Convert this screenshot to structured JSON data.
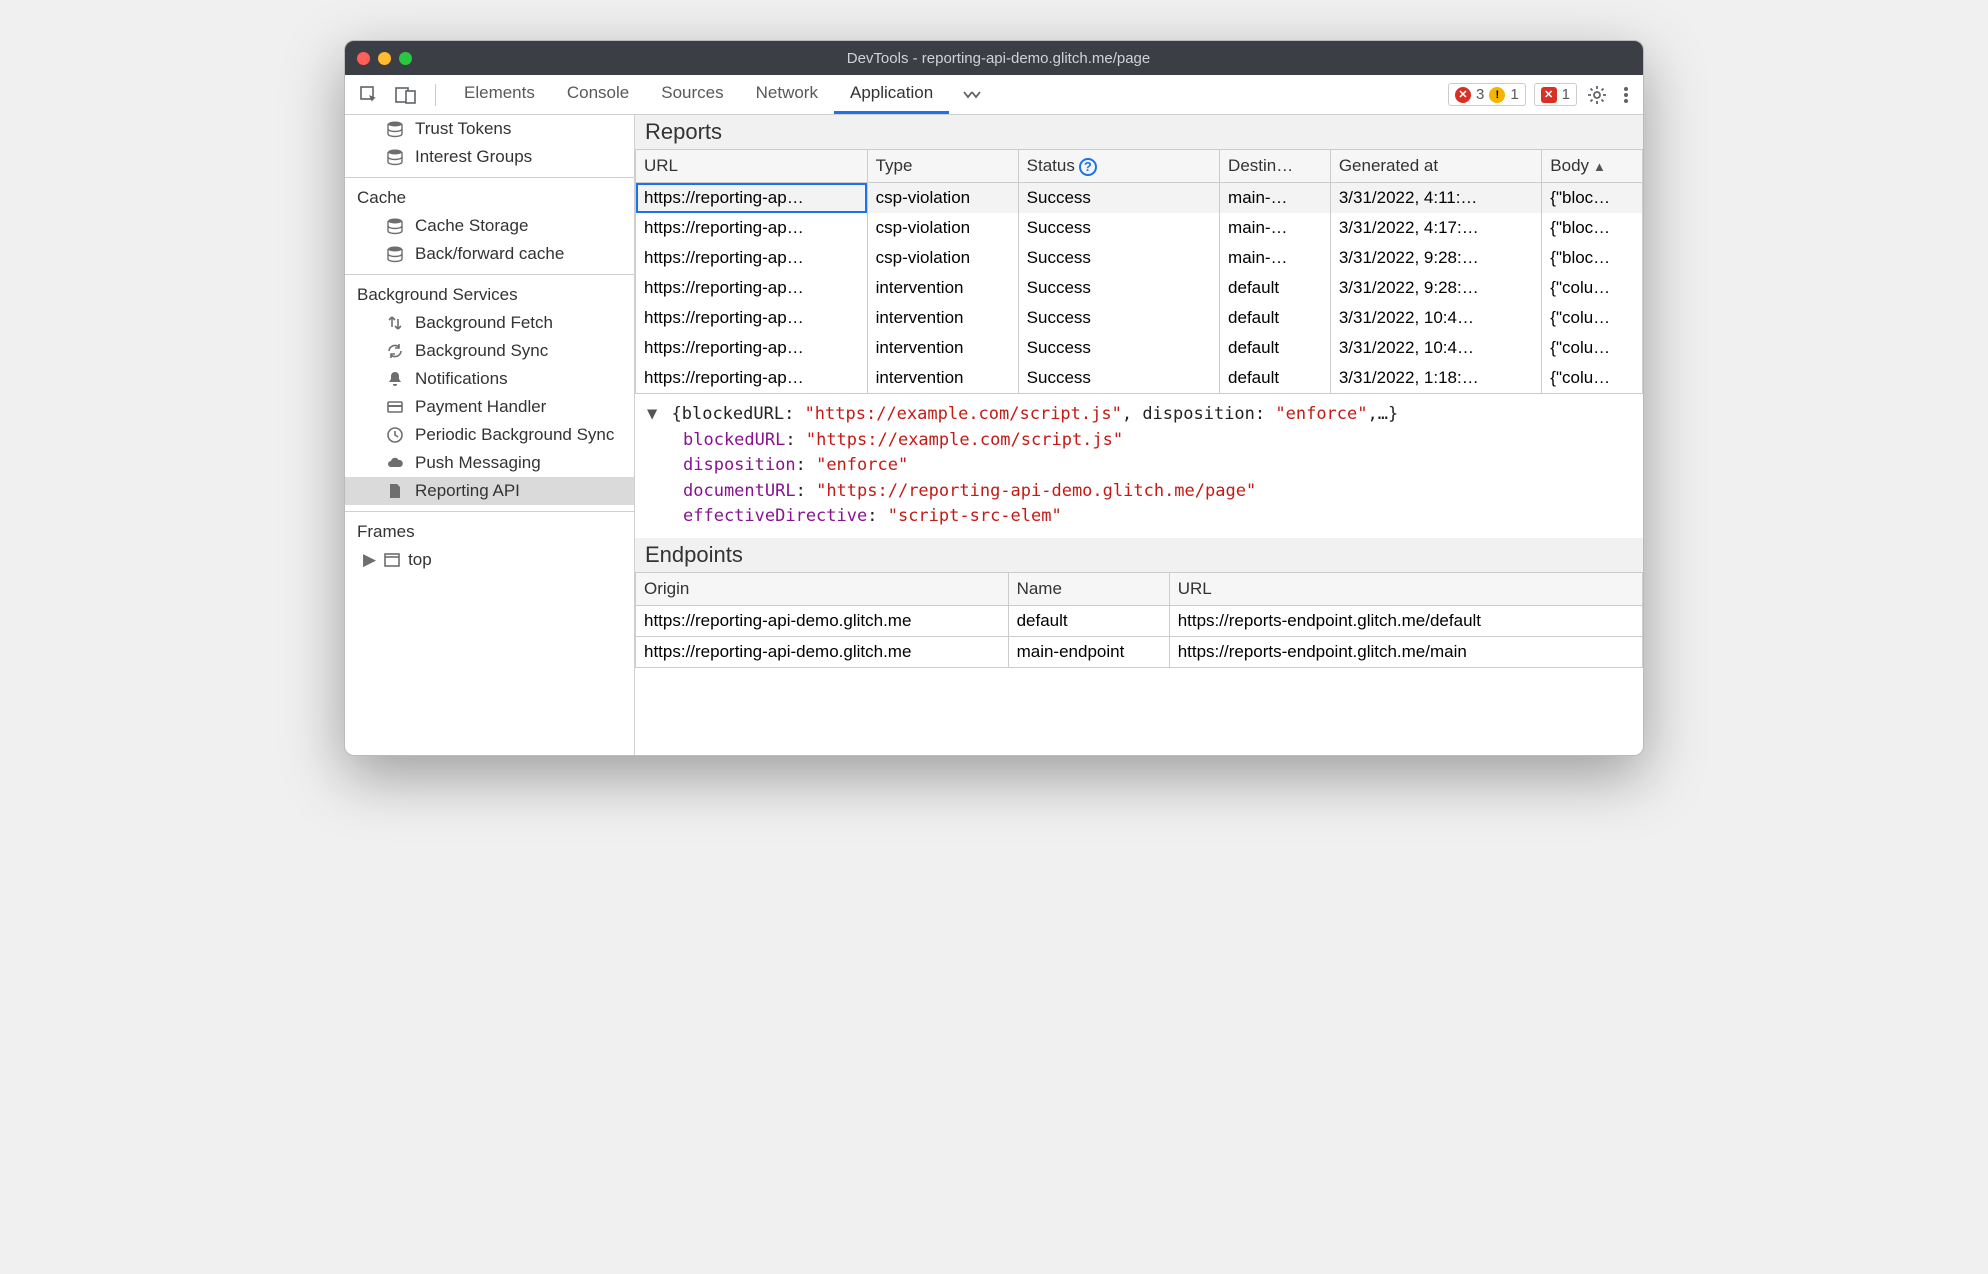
{
  "window": {
    "title": "DevTools - reporting-api-demo.glitch.me/page"
  },
  "toolbar": {
    "tabs": [
      "Elements",
      "Console",
      "Sources",
      "Network",
      "Application"
    ],
    "active_tab": "Application",
    "errors": "3",
    "warnings": "1",
    "issues": "1"
  },
  "sidebar": {
    "top_items": [
      {
        "label": "Trust Tokens",
        "icon": "database"
      },
      {
        "label": "Interest Groups",
        "icon": "database"
      }
    ],
    "sections": [
      {
        "heading": "Cache",
        "items": [
          {
            "label": "Cache Storage",
            "icon": "database"
          },
          {
            "label": "Back/forward cache",
            "icon": "database"
          }
        ]
      },
      {
        "heading": "Background Services",
        "items": [
          {
            "label": "Background Fetch",
            "icon": "transfer"
          },
          {
            "label": "Background Sync",
            "icon": "sync"
          },
          {
            "label": "Notifications",
            "icon": "bell"
          },
          {
            "label": "Payment Handler",
            "icon": "card"
          },
          {
            "label": "Periodic Background Sync",
            "icon": "clock"
          },
          {
            "label": "Push Messaging",
            "icon": "cloud"
          },
          {
            "label": "Reporting API",
            "icon": "file",
            "selected": true
          }
        ]
      }
    ],
    "frames_heading": "Frames",
    "frame_item": "top"
  },
  "reports": {
    "heading": "Reports",
    "columns": [
      "URL",
      "Type",
      "Status",
      "Destin…",
      "Generated at",
      "Body"
    ],
    "rows": [
      {
        "url": "https://reporting-ap…",
        "type": "csp-violation",
        "status": "Success",
        "dest": "main-…",
        "gen": "3/31/2022, 4:11:…",
        "body": "{\"bloc…",
        "selected": true
      },
      {
        "url": "https://reporting-ap…",
        "type": "csp-violation",
        "status": "Success",
        "dest": "main-…",
        "gen": "3/31/2022, 4:17:…",
        "body": "{\"bloc…"
      },
      {
        "url": "https://reporting-ap…",
        "type": "csp-violation",
        "status": "Success",
        "dest": "main-…",
        "gen": "3/31/2022, 9:28:…",
        "body": "{\"bloc…"
      },
      {
        "url": "https://reporting-ap…",
        "type": "intervention",
        "status": "Success",
        "dest": "default",
        "gen": "3/31/2022, 9:28:…",
        "body": "{\"colu…"
      },
      {
        "url": "https://reporting-ap…",
        "type": "intervention",
        "status": "Success",
        "dest": "default",
        "gen": "3/31/2022, 10:4…",
        "body": "{\"colu…"
      },
      {
        "url": "https://reporting-ap…",
        "type": "intervention",
        "status": "Success",
        "dest": "default",
        "gen": "3/31/2022, 10:4…",
        "body": "{\"colu…"
      },
      {
        "url": "https://reporting-ap…",
        "type": "intervention",
        "status": "Success",
        "dest": "default",
        "gen": "3/31/2022, 1:18:…",
        "body": "{\"colu…"
      }
    ]
  },
  "detail": {
    "summary_prefix": "{blockedURL: ",
    "summary_url": "\"https://example.com/script.js\"",
    "summary_mid": ", disposition: ",
    "summary_disp": "\"enforce\"",
    "summary_suffix": ",…}",
    "props": [
      {
        "key": "blockedURL",
        "value": "\"https://example.com/script.js\""
      },
      {
        "key": "disposition",
        "value": "\"enforce\""
      },
      {
        "key": "documentURL",
        "value": "\"https://reporting-api-demo.glitch.me/page\""
      },
      {
        "key": "effectiveDirective",
        "value": "\"script-src-elem\""
      }
    ]
  },
  "endpoints": {
    "heading": "Endpoints",
    "columns": [
      "Origin",
      "Name",
      "URL"
    ],
    "rows": [
      {
        "origin": "https://reporting-api-demo.glitch.me",
        "name": "default",
        "url": "https://reports-endpoint.glitch.me/default"
      },
      {
        "origin": "https://reporting-api-demo.glitch.me",
        "name": "main-endpoint",
        "url": "https://reports-endpoint.glitch.me/main"
      }
    ]
  }
}
